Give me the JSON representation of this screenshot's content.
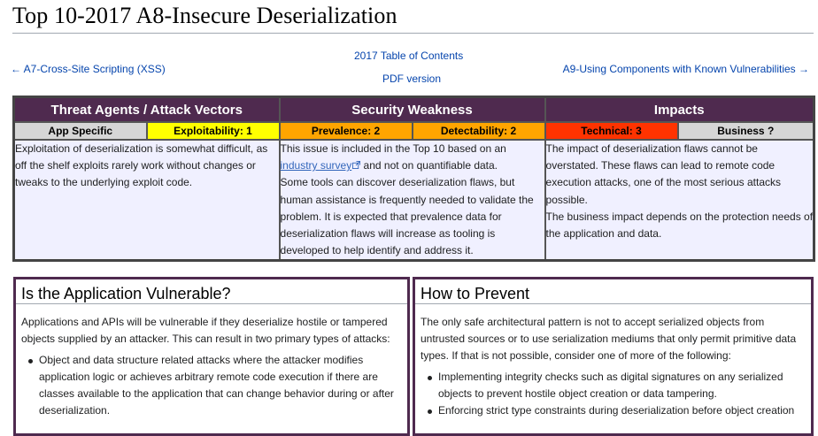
{
  "page": {
    "title": "Top 10-2017 A8-Insecure Deserialization",
    "nav": {
      "prev": "← A7-Cross-Site Scripting (XSS)",
      "toc": "2017 Table of Contents",
      "pdf": "PDF version",
      "next": "A9-Using Components with Known Vulnerabilities →"
    }
  },
  "risk_table": {
    "headers": [
      "Threat Agents / Attack Vectors",
      "Security Weakness",
      "Impacts"
    ],
    "ratings": [
      {
        "label": "App Specific",
        "color": "#d6d6d6"
      },
      {
        "label": "Exploitability: 1",
        "color": "#ffff00"
      },
      {
        "label": "Prevalence: 2",
        "color": "#ffa500"
      },
      {
        "label": "Detectability: 2",
        "color": "#ffa500"
      },
      {
        "label": "Technical: 3",
        "color": "#ff3300"
      },
      {
        "label": "Business ?",
        "color": "#d6d6d6"
      }
    ],
    "threat_text": "Exploitation of deserialization is somewhat difficult, as off the shelf exploits rarely work without changes or tweaks to the underlying exploit code.",
    "weakness": {
      "pre_link": "This issue is included in the Top 10 based on an ",
      "link": "industry survey",
      "post_link": " and not on quantifiable data.",
      "rest": "Some tools can discover deserialization flaws, but human assistance is frequently needed to validate the problem. It is expected that prevalence data for deserialization flaws will increase as tooling is developed to help identify and address it."
    },
    "impacts": {
      "p1": "The impact of deserialization flaws cannot be overstated. These flaws can lead to remote code execution attacks, one of the most serious attacks possible.",
      "p2": "The business impact depends on the protection needs of the application and data."
    }
  },
  "vulnerable": {
    "heading": "Is the Application Vulnerable?",
    "intro": "Applications and APIs will be vulnerable if they deserialize hostile or tampered objects supplied by an attacker. This can result in two primary types of attacks:",
    "items": [
      "Object and data structure related attacks where the attacker modifies application logic or achieves arbitrary remote code execution if there are classes available to the application that can change behavior during or after deserialization."
    ]
  },
  "prevent": {
    "heading": "How to Prevent",
    "intro": "The only safe architectural pattern is not to accept serialized objects from untrusted sources or to use serialization mediums that only permit primitive data types. If that is not possible, consider one of more of the following:",
    "items": [
      "Implementing integrity checks such as digital signatures on any serialized objects to prevent hostile object creation or data tampering.",
      "Enforcing strict type constraints during deserialization before object creation"
    ]
  },
  "colors": {
    "header_bg": "#4f2a4f",
    "cell_bg": "#f0f0ff",
    "link": "#0645ad"
  }
}
